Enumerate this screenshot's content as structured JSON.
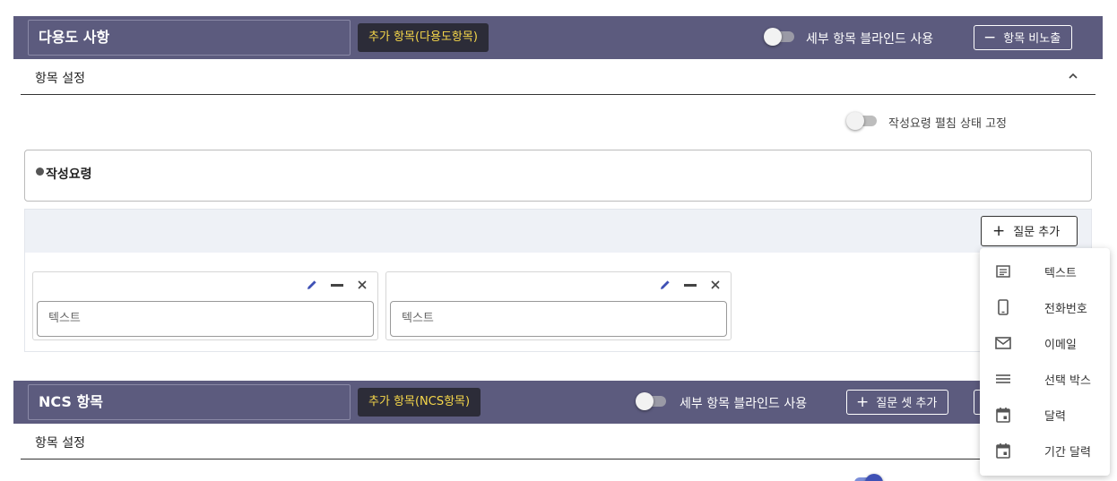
{
  "section1": {
    "title": "다용도 사항",
    "tag": "추가 항목(다용도항목)",
    "blind_label": "세부 항목 블라인드 사용",
    "hide_button": "항목 비노출",
    "settings_label": "항목 설정",
    "fix_label": "작성요령 펼침 상태 고정",
    "guide_title": "작성요령",
    "add_question": "질문 추가",
    "cards": [
      {
        "placeholder": "텍스트"
      },
      {
        "placeholder": "텍스트"
      }
    ]
  },
  "menu": {
    "items": [
      {
        "label": "텍스트",
        "icon": "text-icon"
      },
      {
        "label": "전화번호",
        "icon": "phone-icon"
      },
      {
        "label": "이메일",
        "icon": "email-icon"
      },
      {
        "label": "선택 박스",
        "icon": "list-icon"
      },
      {
        "label": "달력",
        "icon": "calendar-icon"
      },
      {
        "label": "기간 달력",
        "icon": "calendar-range-icon"
      }
    ]
  },
  "section2": {
    "title": "NCS 항목",
    "tag": "추가 항목(NCS항목)",
    "blind_label": "세부 항목 블라인드 사용",
    "add_set_button": "질문 셋 추가",
    "settings_label": "항목 설정"
  },
  "colors": {
    "header_bg": "#5c5b7e",
    "tag_bg": "#2c2c38",
    "tag_text": "#f7d84a",
    "edit_icon": "#3f51b5"
  }
}
